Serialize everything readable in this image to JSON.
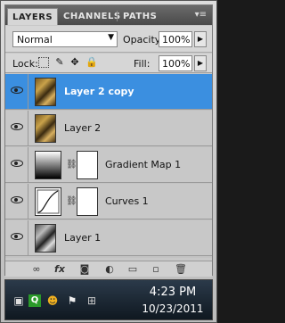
{
  "tabs": [
    {
      "label": "LAYERS",
      "active": true
    },
    {
      "label": "CHANNELS",
      "active": false
    },
    {
      "label": "PATHS",
      "active": false
    }
  ],
  "controls": {
    "blend_mode": "Normal",
    "opacity_label": "Opacity:",
    "opacity_value": "100%",
    "lock_label": "Lock:",
    "fill_label": "Fill:",
    "fill_value": "100%"
  },
  "layers": [
    {
      "name": "Layer 2 copy",
      "type": "photo",
      "selected": true
    },
    {
      "name": "Layer 2",
      "type": "photo",
      "selected": false
    },
    {
      "name": "Gradient Map 1",
      "type": "adjustment-gradient-map",
      "selected": false
    },
    {
      "name": "Curves 1",
      "type": "adjustment-curves",
      "selected": false
    },
    {
      "name": "Layer 1",
      "type": "photo-gray",
      "selected": false
    }
  ],
  "bottom_toolbar": [
    "link-icon",
    "fx-icon",
    "mask-icon",
    "adjustment-icon",
    "folder-icon",
    "new-layer-icon",
    "trash-icon"
  ],
  "taskbar": {
    "time": "4:23 PM",
    "date": "10/23/2011"
  },
  "colors": {
    "selection": "#3b8fe0",
    "panel": "#c8c8c8"
  }
}
